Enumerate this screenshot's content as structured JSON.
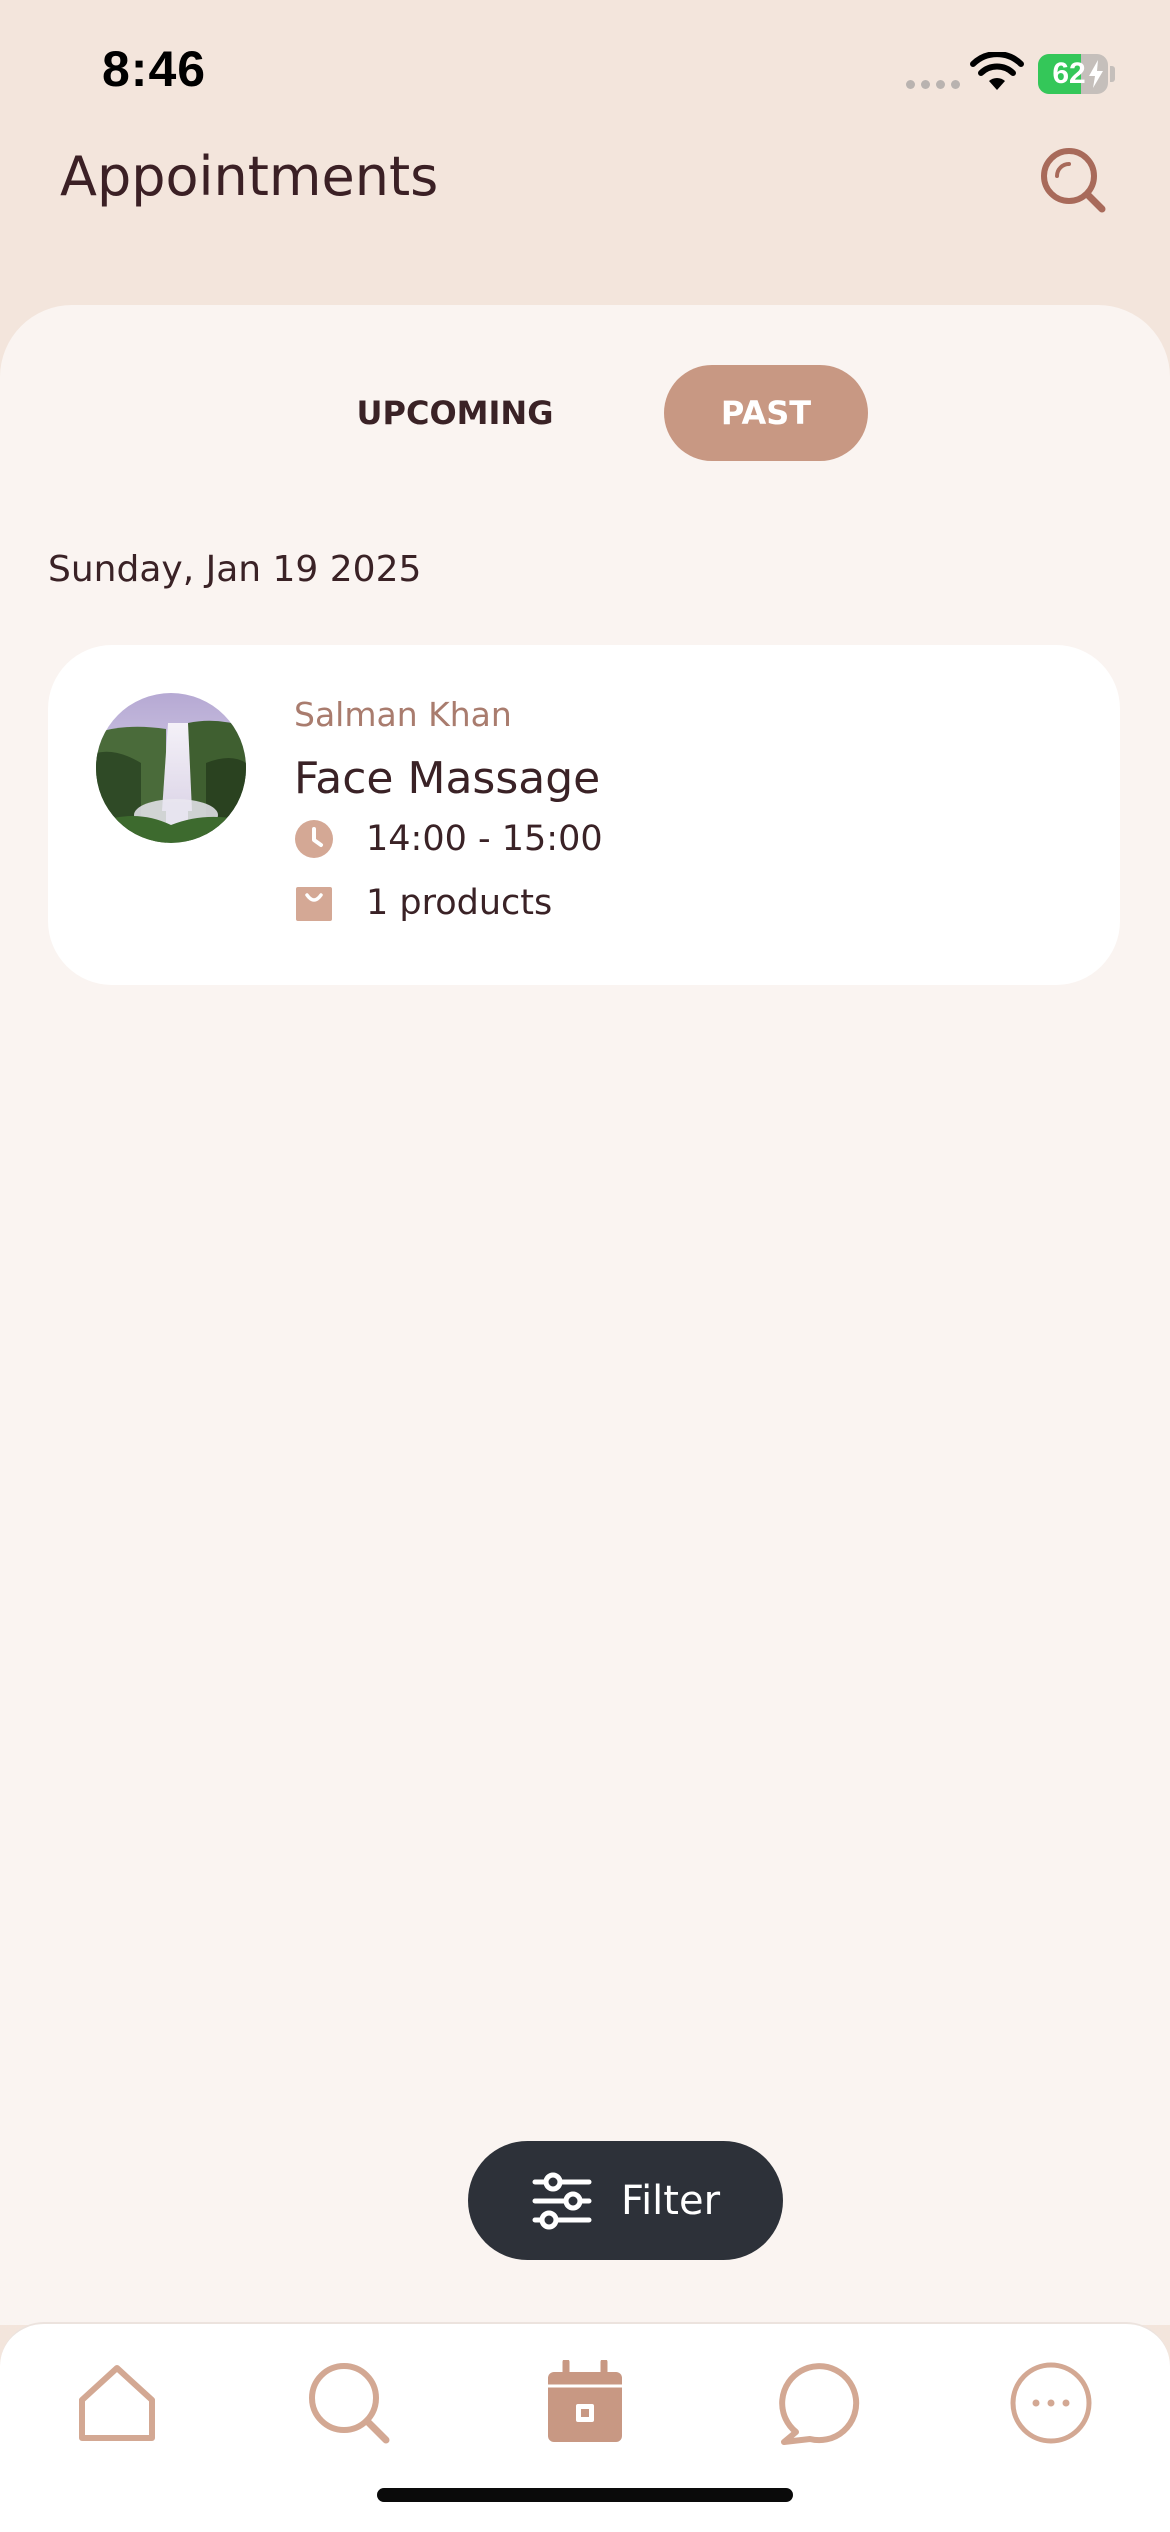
{
  "status_bar": {
    "time": "8:46",
    "battery_level": "62",
    "battery_fraction": 0.62
  },
  "header": {
    "title": "Appointments",
    "search_icon": "search-icon"
  },
  "tabs": [
    {
      "label": "UPCOMING",
      "active": false
    },
    {
      "label": "PAST",
      "active": true
    }
  ],
  "appointments": {
    "date_heading": "Sunday, Jan 19 2025",
    "items": [
      {
        "provider": "Salman Khan",
        "service": "Face Massage",
        "time": "14:00 - 15:00",
        "products": "1 products",
        "avatar_icon": "waterfall-photo"
      }
    ]
  },
  "filter": {
    "label": "Filter",
    "icon": "sliders-icon"
  },
  "bottom_nav": [
    {
      "icon": "home-icon",
      "active": false
    },
    {
      "icon": "search-icon",
      "active": false
    },
    {
      "icon": "calendar-icon",
      "active": true
    },
    {
      "icon": "chat-icon",
      "active": false
    },
    {
      "icon": "more-icon",
      "active": false
    }
  ],
  "colors": {
    "accent": "#c89883",
    "header_bg": "#f3e5dc",
    "sheet_bg": "#faf4f1",
    "text_dark": "#3a2226",
    "provider_text": "#a97c6e",
    "filter_bg": "#2d3139",
    "battery_green": "#34c759"
  }
}
